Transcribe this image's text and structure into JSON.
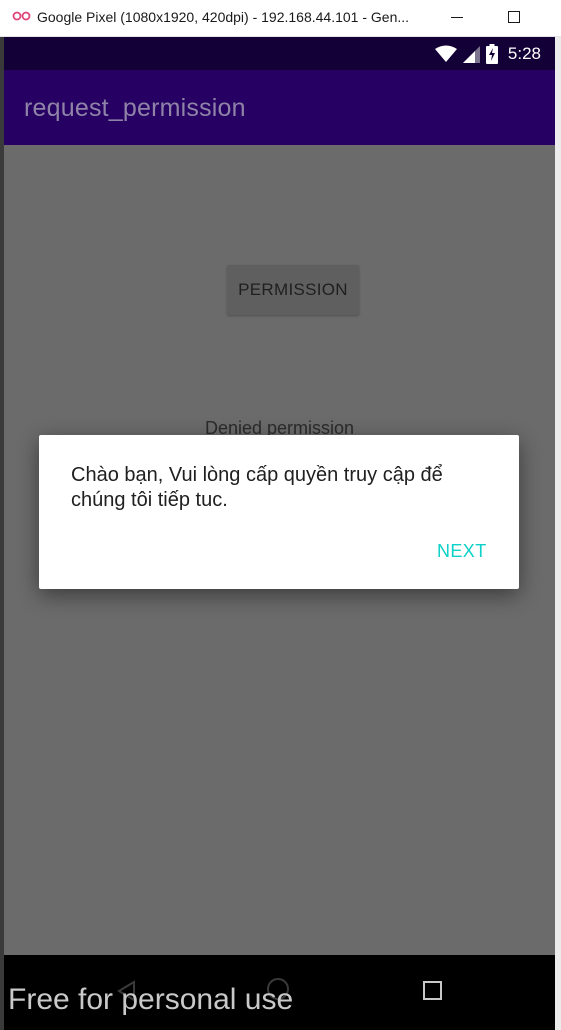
{
  "window": {
    "title": "Google Pixel (1080x1920, 420dpi) - 192.168.44.101 - Gen...",
    "logo_icon": "genymotion-logo-icon",
    "minimize_icon": "minimize-icon",
    "maximize_icon": "maximize-icon"
  },
  "statusbar": {
    "time": "5:28",
    "icons": [
      "wifi-icon",
      "cellular-signal-icon",
      "battery-charging-icon"
    ]
  },
  "appbar": {
    "title": "request_permission",
    "color": "#260062"
  },
  "main": {
    "permission_button_label": "PERMISSION",
    "status_text": "Denied permission"
  },
  "dialog": {
    "message": "Chào bạn, Vui lòng cấp quyền truy cập để chúng tôi tiếp tuc.",
    "next_label": "NEXT",
    "accent_color": "#0bd1c8"
  },
  "navbar": {
    "icons": [
      "back-icon",
      "home-icon",
      "recents-icon"
    ]
  },
  "watermark": "Free for personal use"
}
